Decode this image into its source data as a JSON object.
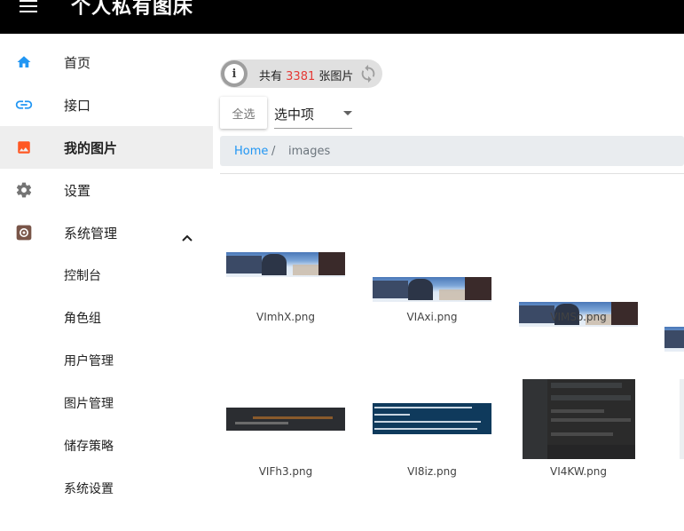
{
  "app": {
    "title": "个人私有图床"
  },
  "sidebar": {
    "items": [
      {
        "label": "首页",
        "icon": "home-icon",
        "color": "#2196f3"
      },
      {
        "label": "接口",
        "icon": "link-icon",
        "color": "#2196f3"
      },
      {
        "label": "我的图片",
        "icon": "image-icon",
        "color": "#ff5722",
        "active": true
      },
      {
        "label": "设置",
        "icon": "gear-icon",
        "color": "#757575"
      },
      {
        "label": "系统管理",
        "icon": "settings-box-icon",
        "color": "#795548",
        "expanded": true
      }
    ],
    "sub_items": [
      {
        "label": "控制台"
      },
      {
        "label": "角色组"
      },
      {
        "label": "用户管理"
      },
      {
        "label": "图片管理"
      },
      {
        "label": "储存策略"
      },
      {
        "label": "系统设置"
      }
    ]
  },
  "main": {
    "count": {
      "prefix": "共有",
      "number": "3381",
      "suffix": "张图片"
    },
    "select_all_label": "全选",
    "select_placeholder": "选中项",
    "breadcrumb": {
      "home": "Home",
      "separator": "/",
      "current": "images"
    },
    "images": [
      {
        "name": "VImhX.png"
      },
      {
        "name": "VIAxi.png"
      },
      {
        "name": "VIMSo.png"
      },
      {
        "name": "VIFh3.png"
      },
      {
        "name": "VI8iz.png"
      },
      {
        "name": "VI4KW.png"
      }
    ]
  },
  "colors": {
    "appbar_bg": "#000000",
    "accent": "#2196f3",
    "count_number": "#e53935",
    "active_bg": "#eeeeee"
  }
}
